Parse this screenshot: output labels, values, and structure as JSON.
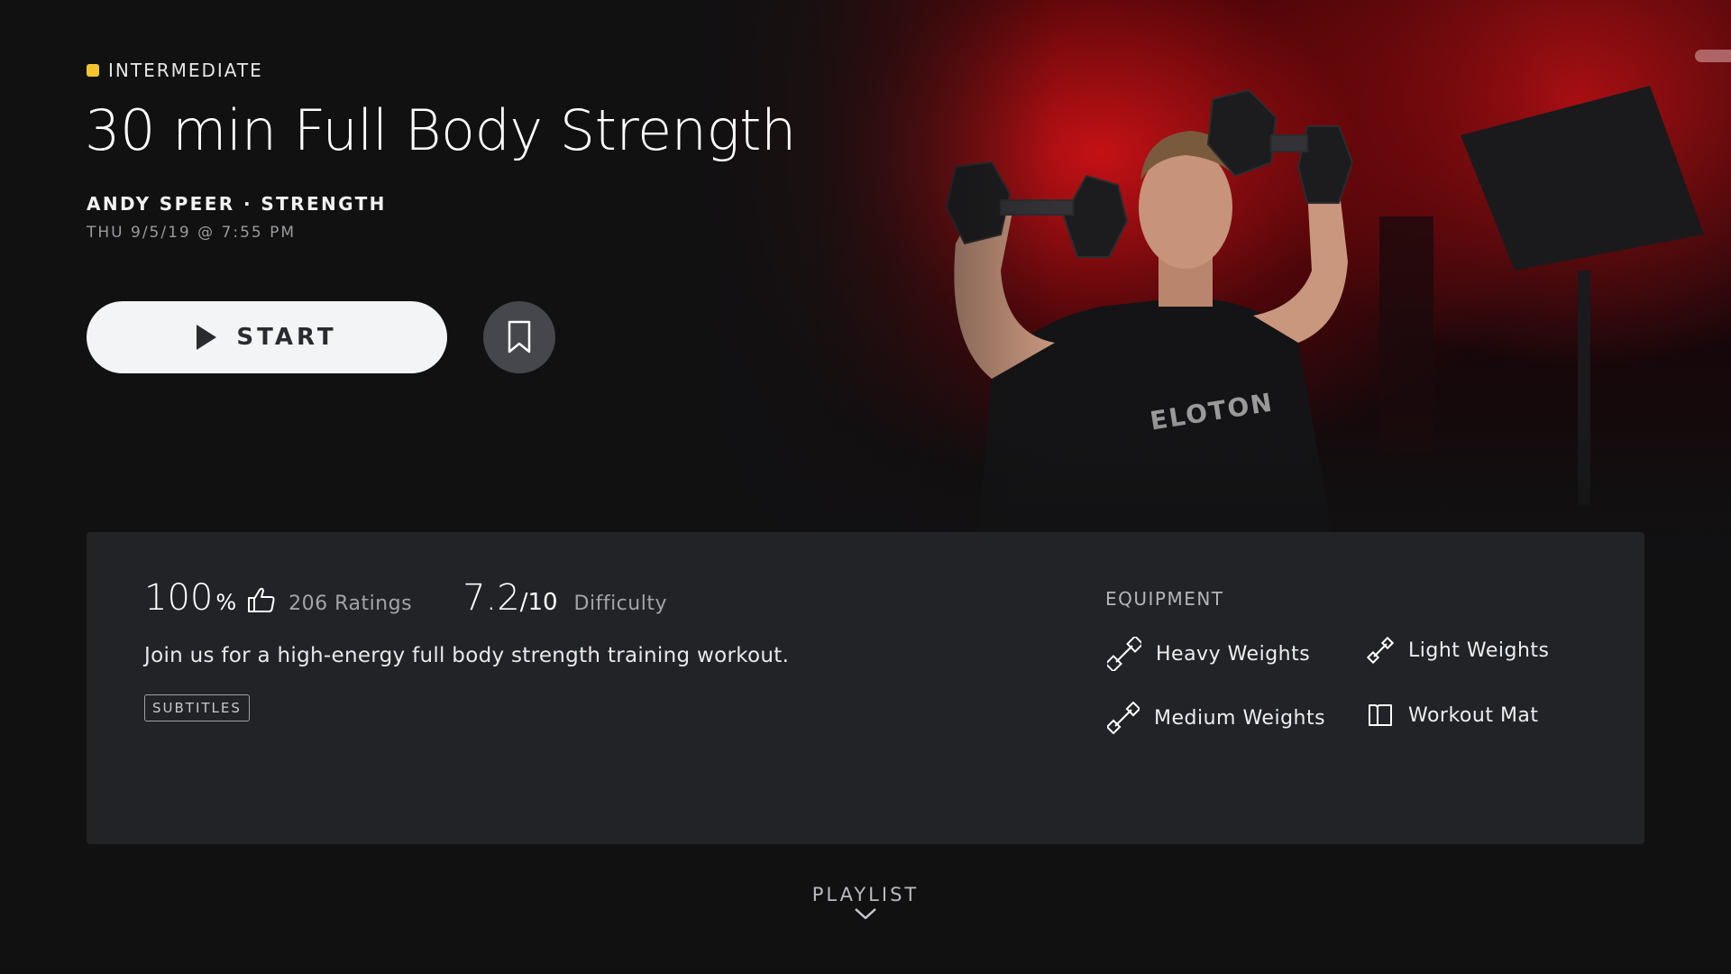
{
  "hero": {
    "shirt_logo": "ELOTON"
  },
  "class": {
    "level": "INTERMEDIATE",
    "title": "30 min Full Body Strength",
    "instructor_line": "ANDY SPEER · STRENGTH",
    "air_date": "THU 9/5/19 @ 7:55 PM"
  },
  "actions": {
    "start_label": "START",
    "bookmark_icon": "bookmark-icon",
    "play_icon": "play-icon"
  },
  "stats": {
    "rating_value": "100",
    "rating_unit": "%",
    "ratings_count": "206 Ratings",
    "difficulty_value": "7.2",
    "difficulty_unit": "/10",
    "difficulty_label": "Difficulty"
  },
  "description": "Join us for a high-energy full body strength training workout.",
  "badge": "SUBTITLES",
  "equipment": {
    "heading": "EQUIPMENT",
    "items": [
      {
        "label": "Heavy Weights",
        "icon": "dumbbell-heavy-icon"
      },
      {
        "label": "Light Weights",
        "icon": "dumbbell-light-icon"
      },
      {
        "label": "Medium Weights",
        "icon": "dumbbell-medium-icon"
      },
      {
        "label": "Workout Mat",
        "icon": "mat-icon"
      }
    ]
  },
  "playlist": {
    "label": "PLAYLIST"
  },
  "colors": {
    "level_dot": "#f4c531",
    "background": "#111112",
    "panel": "#222327",
    "hero_red": "#cd1216"
  }
}
